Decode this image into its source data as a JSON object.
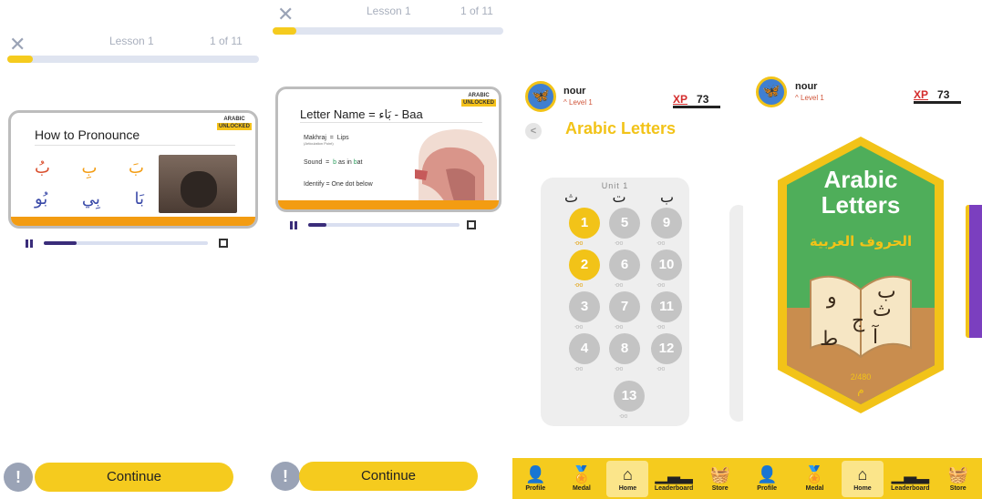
{
  "lesson_screen_1": {
    "lesson_label": "Lesson 1",
    "lesson_count": "1 of 11",
    "progress": 0.1,
    "video_progress": 0.2,
    "card": {
      "brand_top": "ARABIC",
      "brand_bottom": "UNLOCKED",
      "title": "How to Pronounce",
      "letters_row1": [
        "بُ",
        "بِ",
        "بَ"
      ],
      "letters_row2": [
        "بُو",
        "بِي",
        "بَا"
      ]
    },
    "continue_label": "Continue",
    "info_icon": "!"
  },
  "lesson_screen_2": {
    "lesson_label": "Lesson 1",
    "lesson_count": "1 of 11",
    "progress": 0.1,
    "video_progress": 0.12,
    "card": {
      "brand_top": "ARABIC",
      "brand_bottom": "UNLOCKED",
      "title_prefix": "Letter Name = ",
      "title_arabic": "بَاء",
      "title_suffix": " - Baa",
      "makhraj_label": "Makhraj",
      "makhraj_eq": "=",
      "makhraj_value": "Lips",
      "articulation": "(Articulation Point)",
      "sound_label": "Sound",
      "sound_eq": "=",
      "sound_b": "b",
      "sound_as_in": " as in ",
      "sound_word_b": "b",
      "sound_word_rest": "at",
      "identify": "Identify = One dot below"
    },
    "continue_label": "Continue",
    "info_icon": "!"
  },
  "home_screen": {
    "username": "nour",
    "level": "Level 1",
    "level_icon": "^",
    "xp_label": "XP",
    "xp_value": "73",
    "back_icon": "<",
    "title": "Arabic Letters",
    "unit_label": "Unit 1",
    "unit_letters": [
      "ب",
      "ت",
      "ث"
    ],
    "lesson_nodes": [
      {
        "n": "1",
        "active": true
      },
      {
        "n": "2",
        "active": true
      },
      {
        "n": "3",
        "active": false
      },
      {
        "n": "4",
        "active": false
      },
      {
        "n": "5",
        "active": false
      },
      {
        "n": "6",
        "active": false
      },
      {
        "n": "7",
        "active": false
      },
      {
        "n": "8",
        "active": false
      },
      {
        "n": "9",
        "active": false
      },
      {
        "n": "10",
        "active": false
      },
      {
        "n": "11",
        "active": false
      },
      {
        "n": "12",
        "active": false
      },
      {
        "n": "13",
        "active": false
      }
    ]
  },
  "course_screen": {
    "username": "nour",
    "level": "Level 1",
    "level_icon": "^",
    "xp_label": "XP",
    "xp_value": "73",
    "course_title_line1": "Arabic",
    "course_title_line2": "Letters",
    "course_title_arabic": "الحروف العربية",
    "book_letters": [
      "ب",
      "و",
      "ث",
      "ج",
      "ط",
      "آ"
    ],
    "course_progress": "2/480",
    "course_mark": "م"
  },
  "nav": {
    "items": [
      {
        "label": "Profile",
        "icon": "person-icon"
      },
      {
        "label": "Medal",
        "icon": "medal-icon"
      },
      {
        "label": "Home",
        "icon": "home-icon",
        "active": true
      },
      {
        "label": "Leaderboard",
        "icon": "leaderboard-icon"
      },
      {
        "label": "Store",
        "icon": "basket-icon"
      }
    ]
  },
  "colors": {
    "accent": "#f5cb1e",
    "orange": "#f39c12",
    "green": "#4caf50",
    "purple": "#3a2d7a",
    "red": "#d42d2d"
  }
}
